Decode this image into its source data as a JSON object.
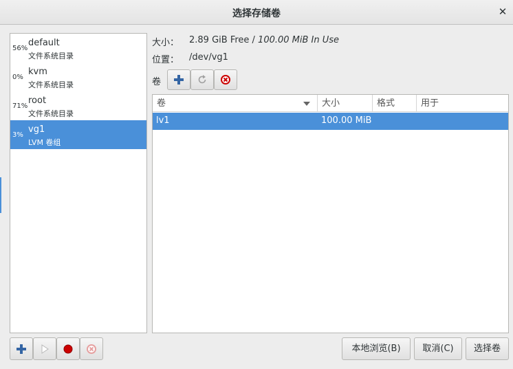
{
  "window": {
    "title": "选择存储卷",
    "close_icon": "close-icon"
  },
  "pools": [
    {
      "percent": "56%",
      "name": "default",
      "type": "文件系统目录",
      "selected": false
    },
    {
      "percent": "0%",
      "name": "kvm",
      "type": "文件系统目录",
      "selected": false
    },
    {
      "percent": "71%",
      "name": "root",
      "type": "文件系统目录",
      "selected": false
    },
    {
      "percent": "3%",
      "name": "vg1",
      "type": "LVM 卷组",
      "selected": true
    }
  ],
  "pool_details": {
    "size_label": "大小：",
    "size_value": "2.89 GiB Free / ",
    "size_in_use": "100.00 MiB In Use",
    "location_label": "位置：",
    "location_value": "/dev/vg1",
    "volumes_label": "卷"
  },
  "volume_table": {
    "columns": [
      "卷",
      "大小",
      "格式",
      "用于"
    ],
    "rows": [
      {
        "name": "lv1",
        "size": "100.00 MiB",
        "format": "",
        "used_by": "",
        "selected": true
      }
    ]
  },
  "buttons": {
    "browse_local": "本地浏览(B)",
    "cancel": "取消(C)",
    "choose_volume": "选择卷"
  },
  "colors": {
    "selection": "#4a90d9",
    "stop_red": "#cc0000",
    "add_blue": "#3465a4"
  }
}
